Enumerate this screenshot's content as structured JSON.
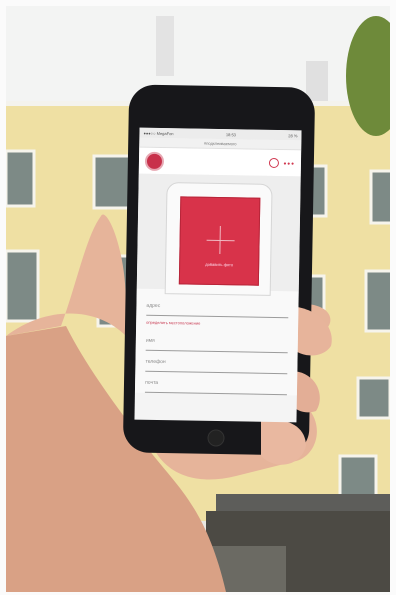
{
  "colors": {
    "accent": "#d8334a",
    "phone_body": "#17171a",
    "wall": "#f0e2a6",
    "sky": "#eef1f4"
  },
  "status": {
    "carrier": "●●●○○ MegaFon",
    "time": "18:53",
    "battery": "28 %"
  },
  "browser": {
    "url": "#подклеиваемого"
  },
  "header": {
    "logo_icon": "logo-icon",
    "user_icon": "user-icon",
    "menu_icon": "more-dots-icon",
    "dots": "•••"
  },
  "hero": {
    "plus_icon": "plus-icon",
    "add_label": "добавить фото"
  },
  "form": {
    "address": "адрес",
    "geo_link": "определить местоположение",
    "name": "имя",
    "phone": "телефон",
    "email": "почта"
  }
}
